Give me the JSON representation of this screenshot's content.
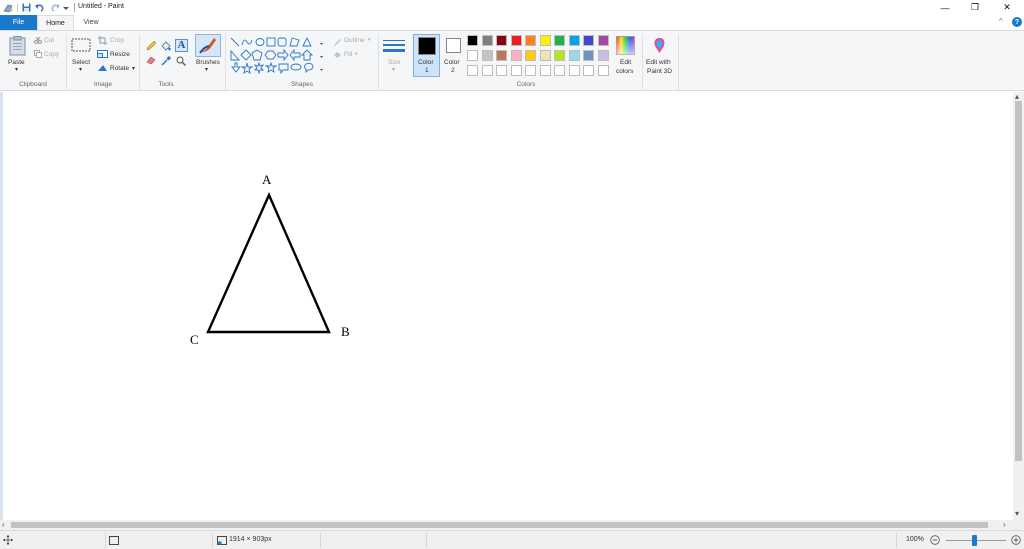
{
  "titlebar": {
    "title": "Untitled - Paint",
    "minimize": "—",
    "restore": "❐",
    "close": "✕"
  },
  "tabs": {
    "file": "File",
    "home": "Home",
    "view": "View",
    "collapse": "^",
    "help": "?"
  },
  "clipboard": {
    "paste": "Paste",
    "cut": "Cut",
    "copy": "Copy",
    "label": "Clipboard"
  },
  "image": {
    "select": "Select",
    "crop": "Crop",
    "resize": "Resize",
    "rotate": "Rotate",
    "label": "Image"
  },
  "tools": {
    "brushes": "Brushes",
    "label": "Tools"
  },
  "shapes": {
    "outline": "Outline",
    "fill": "Fill",
    "label": "Shapes"
  },
  "size": {
    "label": "Size"
  },
  "colors": {
    "color1_line1": "Color",
    "color1_line2": "1",
    "color2_line1": "Color",
    "color2_line2": "2",
    "edit_line1": "Edit",
    "edit_line2": "colors",
    "paint3d_line1": "Edit with",
    "paint3d_line2": "Paint 3D",
    "label": "Colors",
    "color1": "#000000",
    "color2": "#ffffff",
    "palette_row1": [
      "#000000",
      "#7f7f7f",
      "#880015",
      "#ed1c24",
      "#ff7f27",
      "#fff200",
      "#22b14c",
      "#00a2e8",
      "#3f48cc",
      "#a349a4"
    ],
    "palette_row2": [
      "#ffffff",
      "#c3c3c3",
      "#b97a57",
      "#ffaec9",
      "#ffc90e",
      "#efe4b0",
      "#b5e61d",
      "#99d9ea",
      "#7092be",
      "#c8bfe7"
    ],
    "palette_row3": [
      "#ffffff",
      "#ffffff",
      "#ffffff",
      "#ffffff",
      "#ffffff",
      "#ffffff",
      "#ffffff",
      "#ffffff",
      "#ffffff",
      "#ffffff"
    ]
  },
  "canvas": {
    "vertex_a": "A",
    "vertex_b": "B",
    "vertex_c": "C"
  },
  "status": {
    "dimensions": "1914 × 903px",
    "zoom": "100%"
  }
}
